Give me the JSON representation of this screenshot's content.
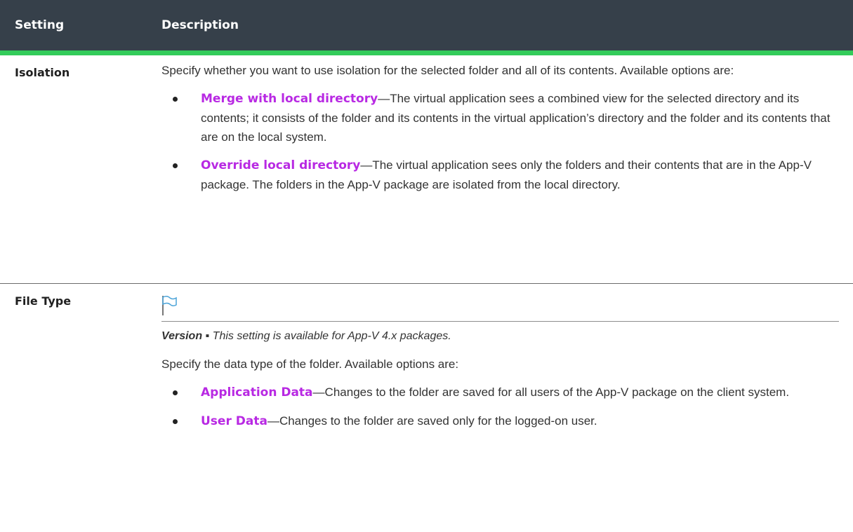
{
  "header": {
    "col1": "Setting",
    "col2": "Description"
  },
  "rows": [
    {
      "label": "Isolation",
      "intro": "Specify whether you want to use isolation for the selected folder and all of its contents. Available options are:",
      "options": [
        {
          "term": "Merge with local directory",
          "text": "—The virtual application sees a combined view for the selected directory and its contents; it consists of the folder and its contents in the virtual application’s directory and the folder and its contents that are on the local system."
        },
        {
          "term": "Override local directory",
          "text": "—The virtual application sees only the folders and their contents that are in the App-V package. The folders in the App-V package are isolated from the local directory."
        }
      ]
    },
    {
      "label": "File Type",
      "version_label": "Version ▪",
      "version_text": " This setting is available for App-V 4.x packages.",
      "intro": "Specify the data type of the folder. Available options are:",
      "options": [
        {
          "term": "Application Data",
          "text": "—Changes to the folder are saved for all users of the App-V package on the client system."
        },
        {
          "term": "User Data",
          "text": "—Changes to the folder are saved only for the logged-on user."
        }
      ]
    }
  ],
  "icons": {
    "version_flag": "flag-icon"
  },
  "colors": {
    "header_bg": "#36404a",
    "accent": "#33cc5a",
    "link": "#b829e3"
  }
}
